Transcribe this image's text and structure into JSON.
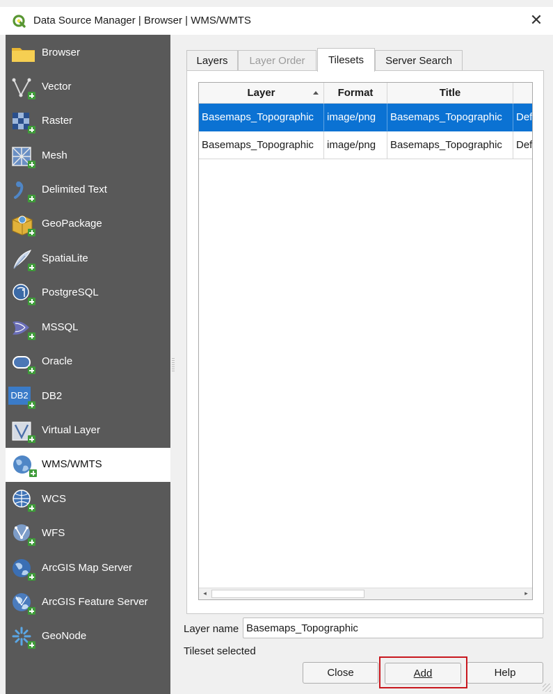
{
  "window": {
    "title": "Data Source Manager | Browser | WMS/WMTS",
    "close_glyph": "✕"
  },
  "sidebar": {
    "items": [
      {
        "label": "Browser",
        "icon": "folder-icon"
      },
      {
        "label": "Vector",
        "icon": "vector-icon"
      },
      {
        "label": "Raster",
        "icon": "raster-icon"
      },
      {
        "label": "Mesh",
        "icon": "mesh-icon"
      },
      {
        "label": "Delimited Text",
        "icon": "delimited-text-icon"
      },
      {
        "label": "GeoPackage",
        "icon": "geopackage-icon"
      },
      {
        "label": "SpatiaLite",
        "icon": "spatialite-icon"
      },
      {
        "label": "PostgreSQL",
        "icon": "postgresql-icon"
      },
      {
        "label": "MSSQL",
        "icon": "mssql-icon"
      },
      {
        "label": "Oracle",
        "icon": "oracle-icon"
      },
      {
        "label": "DB2",
        "icon": "db2-icon",
        "icon_text": "DB2"
      },
      {
        "label": "Virtual Layer",
        "icon": "virtual-layer-icon"
      },
      {
        "label": "WMS/WMTS",
        "icon": "wms-icon",
        "selected": true
      },
      {
        "label": "WCS",
        "icon": "wcs-icon"
      },
      {
        "label": "WFS",
        "icon": "wfs-icon"
      },
      {
        "label": "ArcGIS Map Server",
        "icon": "arcgis-map-server-icon"
      },
      {
        "label": "ArcGIS Feature Server",
        "icon": "arcgis-feature-server-icon"
      },
      {
        "label": "GeoNode",
        "icon": "geonode-icon"
      }
    ]
  },
  "tabs": [
    {
      "label": "Layers",
      "state": "normal"
    },
    {
      "label": "Layer Order",
      "state": "disabled"
    },
    {
      "label": "Tilesets",
      "state": "active"
    },
    {
      "label": "Server Search",
      "state": "normal"
    }
  ],
  "table": {
    "columns": [
      "Layer",
      "Format",
      "Title",
      ""
    ],
    "sorted_column": "Layer",
    "sort_direction": "ascending",
    "rows": [
      {
        "cells": [
          "Basemaps_Topographic",
          "image/png",
          "Basemaps_Topographic",
          "Def"
        ],
        "selected": true
      },
      {
        "cells": [
          "Basemaps_Topographic",
          "image/png",
          "Basemaps_Topographic",
          "Def"
        ],
        "selected": false
      }
    ],
    "scroll_left_glyph": "◂",
    "scroll_right_glyph": "▸"
  },
  "layer_name": {
    "label": "Layer name",
    "value": "Basemaps_Topographic"
  },
  "status_text": "Tileset selected",
  "buttons": {
    "close": "Close",
    "add": "Add",
    "help": "Help"
  },
  "colors": {
    "sidebar_bg": "#595959",
    "selection_blue": "#0b72d3",
    "highlight_red": "#c8161d",
    "qgis_green": "#589632"
  }
}
